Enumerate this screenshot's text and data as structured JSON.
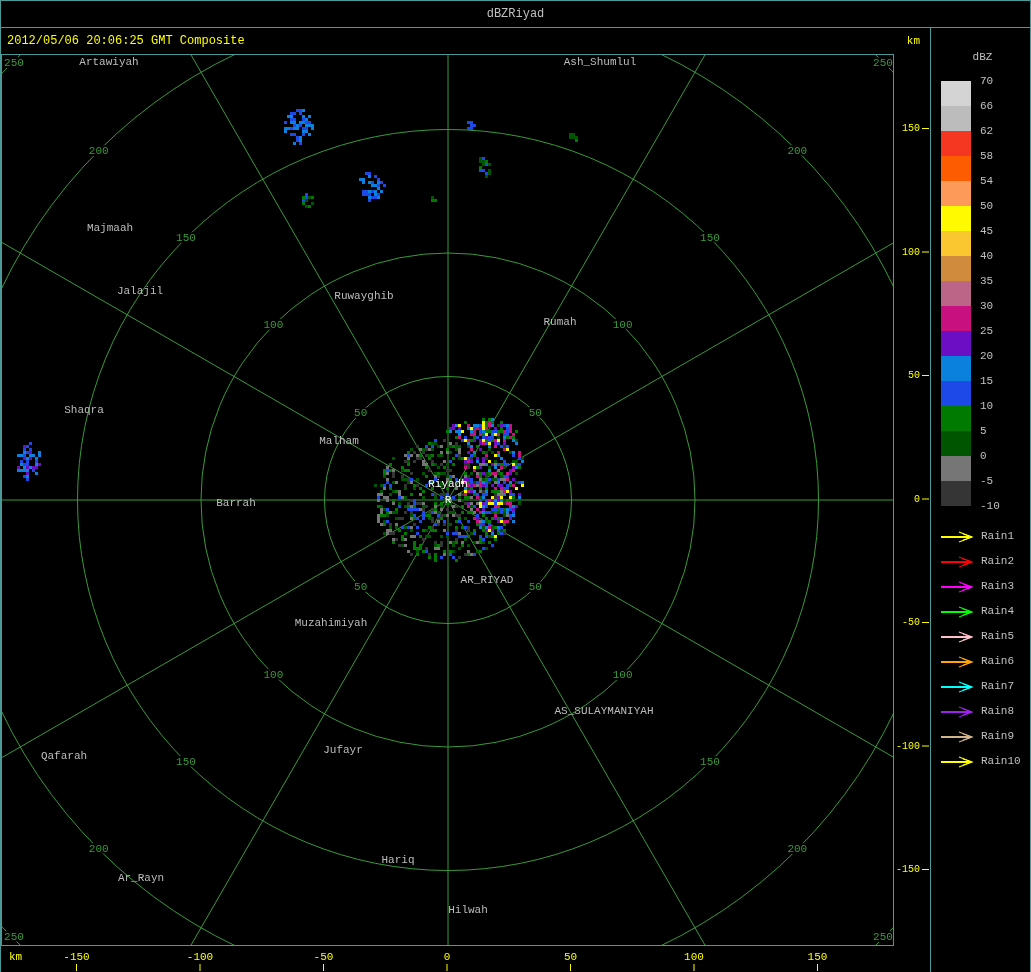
{
  "window": {
    "title": "dBZRiyad"
  },
  "header": {
    "timestamp": "2012/05/06 20:06:25 GMT Composite",
    "unit": "km"
  },
  "map": {
    "ring_labels": [
      {
        "labels": [
          "50",
          "50",
          "50",
          "50"
        ]
      },
      {
        "labels": [
          "100",
          "100",
          "100",
          "100"
        ]
      },
      {
        "labels": [
          "150",
          "150",
          "150",
          "150"
        ]
      },
      {
        "labels": [
          "200",
          "200",
          "200",
          "200"
        ]
      },
      {
        "labels": [
          "250",
          "250",
          "250",
          "250"
        ]
      }
    ],
    "places": [
      {
        "name": "Artawiyah",
        "kind": "city"
      },
      {
        "name": "Ash_Shumlul",
        "kind": "city"
      },
      {
        "name": "Majmaah",
        "kind": "city"
      },
      {
        "name": "Jalajil",
        "kind": "city"
      },
      {
        "name": "Ruwayghib",
        "kind": "city"
      },
      {
        "name": "Rumah",
        "kind": "city"
      },
      {
        "name": "Shaqra",
        "kind": "city"
      },
      {
        "name": "Malham",
        "kind": "city"
      },
      {
        "name": "Riyadh",
        "kind": "radar"
      },
      {
        "name": "R",
        "kind": "radar"
      },
      {
        "name": "Barrah",
        "kind": "city"
      },
      {
        "name": "AR_RIYAD",
        "kind": "city"
      },
      {
        "name": "Muzahimiyah",
        "kind": "city"
      },
      {
        "name": "AS_SULAYMANIYAH",
        "kind": "city"
      },
      {
        "name": "Qafarah",
        "kind": "city"
      },
      {
        "name": "Jufayr",
        "kind": "city"
      },
      {
        "name": "Hariq",
        "kind": "city"
      },
      {
        "name": "Ar_Rayn",
        "kind": "city"
      },
      {
        "name": "Hilwah",
        "kind": "city"
      }
    ]
  },
  "y_axis": {
    "ticks": [
      "150",
      "100",
      "50",
      "0",
      "-50",
      "-100",
      "-150"
    ]
  },
  "x_axis": {
    "unit": "km",
    "ticks": [
      "-150",
      "-100",
      "-50",
      "0",
      "50",
      "100",
      "150"
    ]
  },
  "legend": {
    "title": "dBZ",
    "bottom_label": "-10",
    "bands": [
      {
        "label": "70",
        "color": "#d4d4d4"
      },
      {
        "label": "66",
        "color": "#bcbcbc"
      },
      {
        "label": "62",
        "color": "#f53620"
      },
      {
        "label": "58",
        "color": "#fd5c00"
      },
      {
        "label": "54",
        "color": "#fd9a5a"
      },
      {
        "label": "50",
        "color": "#fefb00"
      },
      {
        "label": "45",
        "color": "#fbc731"
      },
      {
        "label": "40",
        "color": "#d08b3d"
      },
      {
        "label": "35",
        "color": "#bb6686"
      },
      {
        "label": "30",
        "color": "#c8107f"
      },
      {
        "label": "25",
        "color": "#6b0ec4"
      },
      {
        "label": "20",
        "color": "#0a81dc"
      },
      {
        "label": "15",
        "color": "#1c49e8"
      },
      {
        "label": "10",
        "color": "#007b00"
      },
      {
        "label": "5",
        "color": "#005600"
      },
      {
        "label": "0",
        "color": "#767676"
      },
      {
        "label": "-5",
        "color": "#353535"
      }
    ],
    "tracks": [
      {
        "name": "Rain1",
        "color": "#ffff00"
      },
      {
        "name": "Rain2",
        "color": "#ff0000"
      },
      {
        "name": "Rain3",
        "color": "#ff00ff"
      },
      {
        "name": "Rain4",
        "color": "#00ff00"
      },
      {
        "name": "Rain5",
        "color": "#ffc0cb"
      },
      {
        "name": "Rain6",
        "color": "#ffa500"
      },
      {
        "name": "Rain7",
        "color": "#00ffff"
      },
      {
        "name": "Rain8",
        "color": "#a020f0"
      },
      {
        "name": "Rain9",
        "color": "#d2b48c"
      },
      {
        "name": "Rain10",
        "color": "#ffff00"
      }
    ]
  }
}
